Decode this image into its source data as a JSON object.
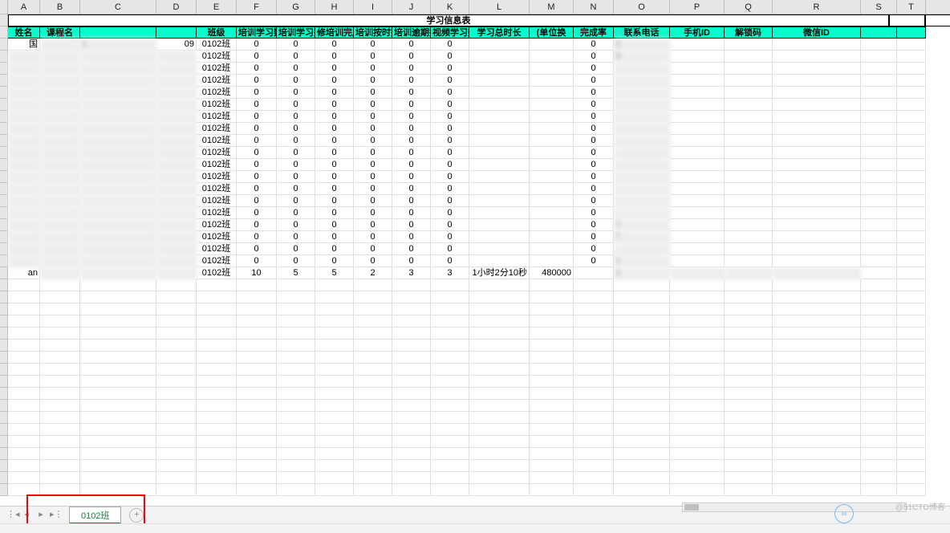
{
  "columns": [
    "A",
    "B",
    "C",
    "D",
    "E",
    "F",
    "G",
    "H",
    "I",
    "J",
    "K",
    "L",
    "M",
    "N",
    "O",
    "P",
    "Q",
    "R",
    "S",
    "T"
  ],
  "title": "学习信息表",
  "headers": {
    "A": "姓名",
    "B": "课程名",
    "C": "",
    "D": "",
    "E": "班级",
    "F": "培训学习数",
    "G": "培训学习完成",
    "H": "修培训完成",
    "I": "培训按时完",
    "J": "培训逾期完",
    "K": "视频学习数",
    "L": "学习总时长",
    "M": "(单位换",
    "N": "完成率",
    "O": "联系电话",
    "P": "手机ID",
    "Q": "解锁码",
    "R": "微信ID"
  },
  "rows": [
    {
      "name": "国",
      "class": "0102班",
      "c": "1",
      "d": "09",
      "f": 0,
      "g": 0,
      "h": 0,
      "i": 0,
      "j": 0,
      "k": 0,
      "n": 0,
      "o": "2",
      "l": "",
      "m": ""
    },
    {
      "name": "",
      "class": "0102班",
      "f": 0,
      "g": 0,
      "h": 0,
      "i": 0,
      "j": 0,
      "k": 0,
      "n": 0,
      "o": "9",
      "l": "",
      "m": ""
    },
    {
      "name": "",
      "class": "0102班",
      "f": 0,
      "g": 0,
      "h": 0,
      "i": 0,
      "j": 0,
      "k": 0,
      "n": 0,
      "o": "",
      "l": "",
      "m": ""
    },
    {
      "name": "",
      "class": "0102班",
      "f": 0,
      "g": 0,
      "h": 0,
      "i": 0,
      "j": 0,
      "k": 0,
      "n": 0,
      "o": "",
      "l": "",
      "m": ""
    },
    {
      "name": "",
      "class": "0102班",
      "f": 0,
      "g": 0,
      "h": 0,
      "i": 0,
      "j": 0,
      "k": 0,
      "n": 0,
      "o": "",
      "l": "",
      "m": ""
    },
    {
      "name": "",
      "class": "0102班",
      "f": 0,
      "g": 0,
      "h": 0,
      "i": 0,
      "j": 0,
      "k": 0,
      "n": 0,
      "o": "",
      "l": "",
      "m": ""
    },
    {
      "name": "",
      "class": "0102班",
      "f": 0,
      "g": 0,
      "h": 0,
      "i": 0,
      "j": 0,
      "k": 0,
      "n": 0,
      "o": "",
      "l": "",
      "m": ""
    },
    {
      "name": "",
      "class": "0102班",
      "f": 0,
      "g": 0,
      "h": 0,
      "i": 0,
      "j": 0,
      "k": 0,
      "n": 0,
      "o": "",
      "l": "",
      "m": ""
    },
    {
      "name": "",
      "class": "0102班",
      "f": 0,
      "g": 0,
      "h": 0,
      "i": 0,
      "j": 0,
      "k": 0,
      "n": 0,
      "o": "",
      "l": "",
      "m": ""
    },
    {
      "name": "",
      "class": "0102班",
      "f": 0,
      "g": 0,
      "h": 0,
      "i": 0,
      "j": 0,
      "k": 0,
      "n": 0,
      "o": "",
      "l": "",
      "m": ""
    },
    {
      "name": "",
      "class": "0102班",
      "f": 0,
      "g": 0,
      "h": 0,
      "i": 0,
      "j": 0,
      "k": 0,
      "n": 0,
      "o": "",
      "l": "",
      "m": ""
    },
    {
      "name": "",
      "class": "0102班",
      "f": 0,
      "g": 0,
      "h": 0,
      "i": 0,
      "j": 0,
      "k": 0,
      "n": 0,
      "o": "",
      "l": "",
      "m": ""
    },
    {
      "name": "",
      "class": "0102班",
      "f": 0,
      "g": 0,
      "h": 0,
      "i": 0,
      "j": 0,
      "k": 0,
      "n": 0,
      "o": "",
      "l": "",
      "m": ""
    },
    {
      "name": "",
      "class": "0102班",
      "f": 0,
      "g": 0,
      "h": 0,
      "i": 0,
      "j": 0,
      "k": 0,
      "n": 0,
      "o": "",
      "l": "",
      "m": ""
    },
    {
      "name": "",
      "class": "0102班",
      "f": 0,
      "g": 0,
      "h": 0,
      "i": 0,
      "j": 0,
      "k": 0,
      "n": 0,
      "o": "",
      "l": "",
      "m": ""
    },
    {
      "name": "",
      "class": "0102班",
      "f": 0,
      "g": 0,
      "h": 0,
      "i": 0,
      "j": 0,
      "k": 0,
      "n": 0,
      "o": "7",
      "l": "",
      "m": ""
    },
    {
      "name": "",
      "class": "0102班",
      "f": 0,
      "g": 0,
      "h": 0,
      "i": 0,
      "j": 0,
      "k": 0,
      "n": 0,
      "o": "7",
      "l": "",
      "m": ""
    },
    {
      "name": "",
      "class": "0102班",
      "f": 0,
      "g": 0,
      "h": 0,
      "i": 0,
      "j": 0,
      "k": 0,
      "n": 0,
      "o": "",
      "l": "",
      "m": ""
    },
    {
      "name": "",
      "class": "0102班",
      "f": 0,
      "g": 0,
      "h": 0,
      "i": 0,
      "j": 0,
      "k": 0,
      "n": 0,
      "o": "1",
      "l": "",
      "m": ""
    },
    {
      "name": "an",
      "class": "0102班",
      "f": 10,
      "g": 5,
      "h": 5,
      "i": 2,
      "j": 3,
      "k": 3,
      "l": "1小时2分10秒",
      "m": "480000",
      "n": "",
      "o": "1"
    }
  ],
  "sheet_tab": "0102班",
  "watermark": "@51CTO博客"
}
